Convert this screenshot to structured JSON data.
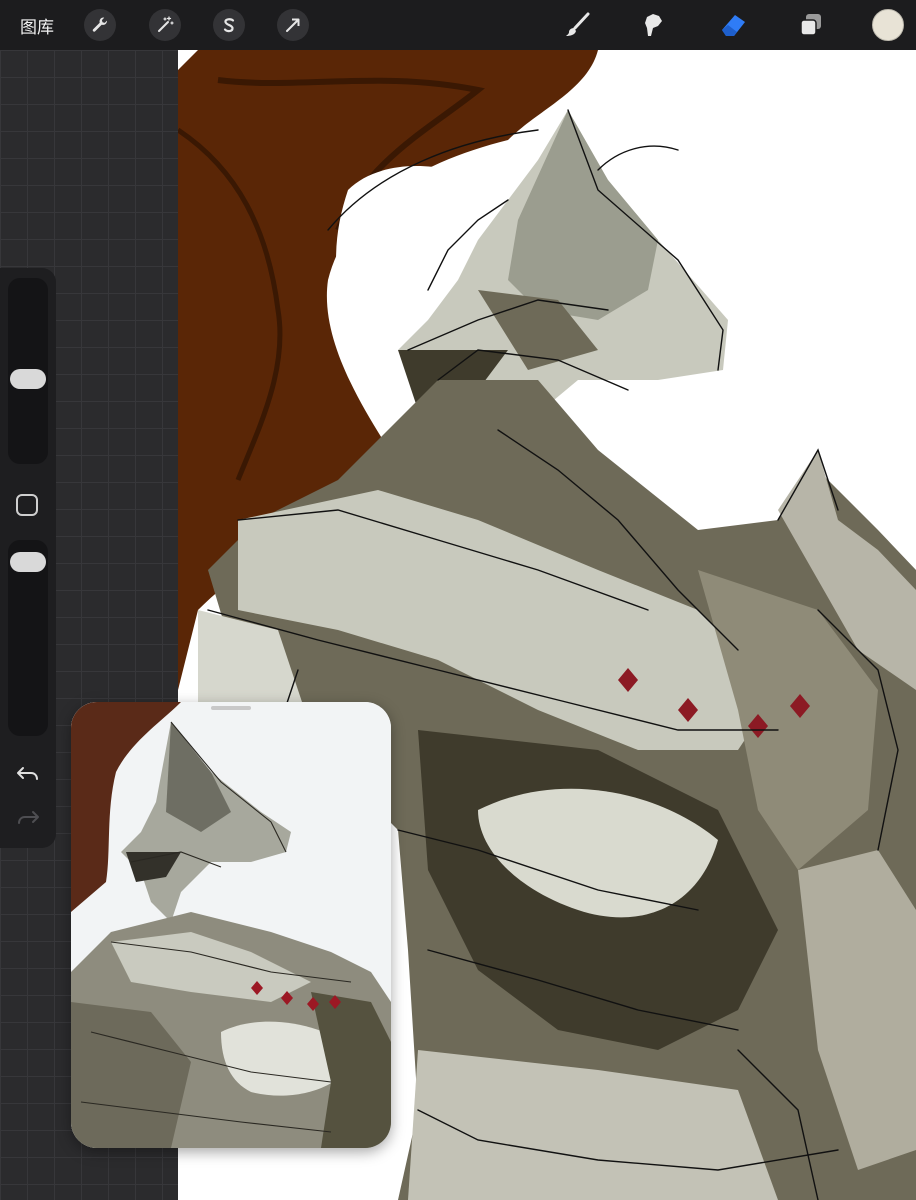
{
  "toolbar": {
    "gallery_label": "图库",
    "left_tools": [
      "wrench-icon",
      "magic-wand-icon",
      "selection-s-icon",
      "arrow-transform-icon"
    ],
    "right_tools": [
      "brush-icon",
      "smudge-icon",
      "eraser-icon",
      "layers-icon"
    ],
    "active_tool": "eraser-icon",
    "accent": "#2f7cf6",
    "current_color": "#e8e3d6"
  },
  "sidebar": {
    "brush_size_level": 0.45,
    "opacity_level": 0.95
  },
  "canvas": {
    "background": "#ffffff",
    "palette": [
      "#5a2606",
      "#6e6a58",
      "#c8c9bd",
      "#3f3b2c",
      "#8c1a24"
    ]
  }
}
